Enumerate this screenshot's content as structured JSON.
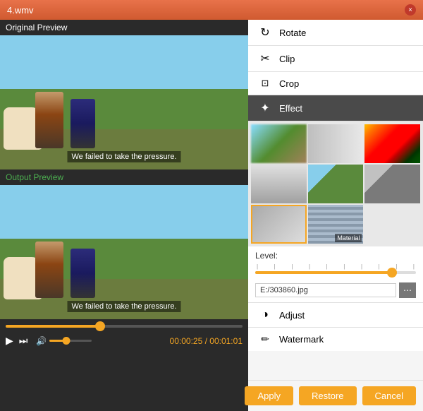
{
  "titlebar": {
    "title": "4.wmv",
    "close_label": "×"
  },
  "left": {
    "original_label": "Original Preview",
    "output_label": "Output Preview",
    "subtitle": "We failed to take the pressure.",
    "time_current": "00:00:25",
    "time_total": "00:01:01"
  },
  "right": {
    "tools": [
      {
        "id": "rotate",
        "label": "Rotate",
        "icon": "↻"
      },
      {
        "id": "clip",
        "label": "Clip",
        "icon": "✂"
      },
      {
        "id": "crop",
        "label": "Crop",
        "icon": "⊞"
      },
      {
        "id": "effect",
        "label": "Effect",
        "icon": "✦"
      }
    ],
    "effects": [
      {
        "id": "e1",
        "label": ""
      },
      {
        "id": "e2",
        "label": ""
      },
      {
        "id": "e3",
        "label": ""
      },
      {
        "id": "e4",
        "label": ""
      },
      {
        "id": "e5",
        "label": ""
      },
      {
        "id": "e6",
        "label": ""
      },
      {
        "id": "e7",
        "label": ""
      },
      {
        "id": "e8",
        "label": "Material"
      }
    ],
    "level_label": "Level:",
    "filepath": "E:/303860.jpg",
    "browse_icon": "⋯",
    "adjust_label": "Adjust",
    "watermark_label": "Watermark",
    "buttons": {
      "apply": "Apply",
      "restore": "Restore",
      "cancel": "Cancel"
    }
  }
}
